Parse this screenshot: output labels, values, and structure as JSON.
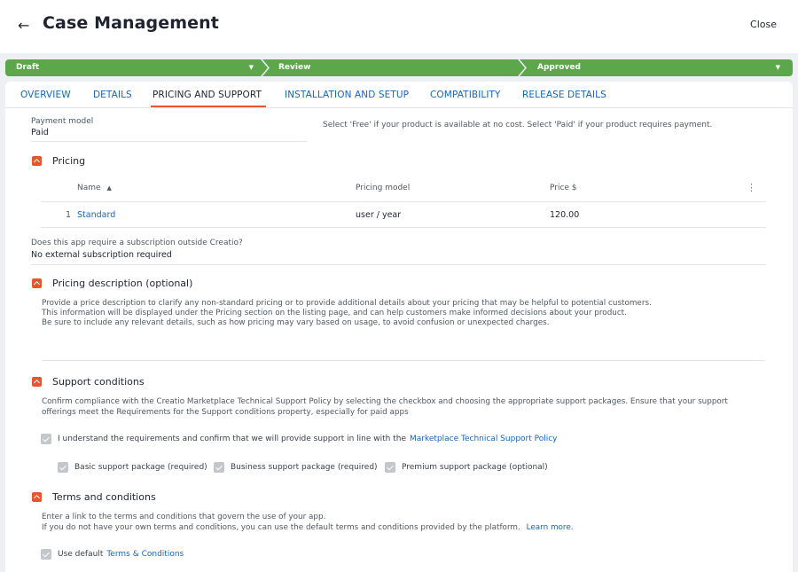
{
  "header": {
    "back_icon": "arrow-left-icon",
    "title": "Case Management",
    "close_label": "Close"
  },
  "stages": [
    {
      "label": "Draft",
      "has_dropdown": true
    },
    {
      "label": "Review",
      "has_dropdown": false
    },
    {
      "label": "Approved",
      "has_dropdown": true
    }
  ],
  "stage_color": "#5aa84a",
  "accent_color": "#e8542c",
  "link_color": "#1565c0",
  "tabs": [
    {
      "label": "OVERVIEW",
      "active": false
    },
    {
      "label": "DETAILS",
      "active": false
    },
    {
      "label": "PRICING AND SUPPORT",
      "active": true
    },
    {
      "label": "INSTALLATION AND SETUP",
      "active": false
    },
    {
      "label": "COMPATIBILITY",
      "active": false
    },
    {
      "label": "RELEASE DETAILS",
      "active": false
    }
  ],
  "payment_model": {
    "label": "Payment model",
    "value": "Paid",
    "hint": "Select 'Free' if your product is available at no cost. Select 'Paid' if your product requires payment."
  },
  "pricing": {
    "title": "Pricing",
    "columns": {
      "name": "Name",
      "sort_icon": "sort-ascending-icon",
      "model": "Pricing model",
      "price": "Price $"
    },
    "rows": [
      {
        "index": "1",
        "name": "Standard",
        "model": "user / year",
        "price": "120.00"
      }
    ]
  },
  "subscription": {
    "label": "Does this app require a subscription outside Creatio?",
    "value": "No external subscription required"
  },
  "pricing_description": {
    "title": "Pricing description (optional)",
    "lines": [
      "Provide a price description to clarify any non-standard pricing or to provide additional details about your pricing that may be helpful to potential customers.",
      "This information will be displayed under the Pricing section on the listing page, and can help customers make informed decisions about your product.",
      "Be sure to include any relevant details, such as how pricing may vary based on usage, to avoid confusion or unexpected charges."
    ]
  },
  "support": {
    "title": "Support conditions",
    "lines": [
      "Confirm compliance with the Creatio Marketplace Technical Support Policy by selecting the checkbox and choosing the appropriate support packages. Ensure that your support",
      "offerings meet the Requirements for the Support conditions property, especially for paid apps"
    ],
    "confirm_text": "I understand the requirements and confirm that we will provide support in line with the",
    "policy_link": "Marketplace Technical Support Policy",
    "packages": [
      {
        "label": "Basic support package (required)",
        "checked": true
      },
      {
        "label": "Business support package (required)",
        "checked": true
      },
      {
        "label": "Premium support package (optional)",
        "checked": true
      }
    ]
  },
  "terms": {
    "title": "Terms and conditions",
    "line1": "Enter a link to the terms and conditions that govern the use of your app.",
    "line2": "If you do not have your own terms and conditions, you can use the default terms and conditions provided by the platform.",
    "learn_more": "Learn more.",
    "default_text": "Use default",
    "default_link": "Terms & Conditions"
  }
}
